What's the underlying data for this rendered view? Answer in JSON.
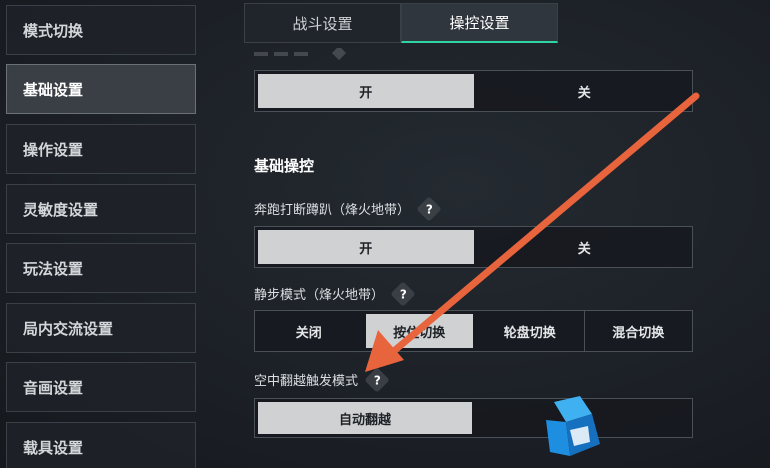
{
  "sidebar": {
    "items": [
      {
        "label": "模式切换"
      },
      {
        "label": "基础设置"
      },
      {
        "label": "操作设置"
      },
      {
        "label": "灵敏度设置"
      },
      {
        "label": "玩法设置"
      },
      {
        "label": "局内交流设置"
      },
      {
        "label": "音画设置"
      },
      {
        "label": "载具设置"
      }
    ],
    "active_index": 1
  },
  "tabs": [
    {
      "label": "战斗设置"
    },
    {
      "label": "操控设置"
    }
  ],
  "active_tab_index": 1,
  "top_toggle": {
    "on_label": "开",
    "off_label": "关",
    "selected": "开"
  },
  "section": {
    "title": "基础操控"
  },
  "settings": {
    "sprint_interrupt": {
      "label": "奔跑打断蹲趴（烽火地带）",
      "help": "?",
      "on_label": "开",
      "off_label": "关",
      "selected": "开"
    },
    "quiet_step": {
      "label": "静步模式（烽火地带）",
      "help": "?",
      "options": [
        "关闭",
        "按住切换",
        "轮盘切换",
        "混合切换"
      ],
      "selected": "按住切换"
    },
    "air_vault": {
      "label": "空中翻越触发模式",
      "help": "?",
      "options": [
        "自动翻越"
      ],
      "selected": "自动翻越"
    }
  },
  "colors": {
    "accent": "#2fd4a5",
    "arrow": "#e8643c",
    "selected_option": "#cfd1d2",
    "logo_blue": "#1e8fe0"
  },
  "icons": {
    "help": "question-diamond-icon",
    "annotation": "orange-arrow",
    "watermark": "site-logo"
  }
}
